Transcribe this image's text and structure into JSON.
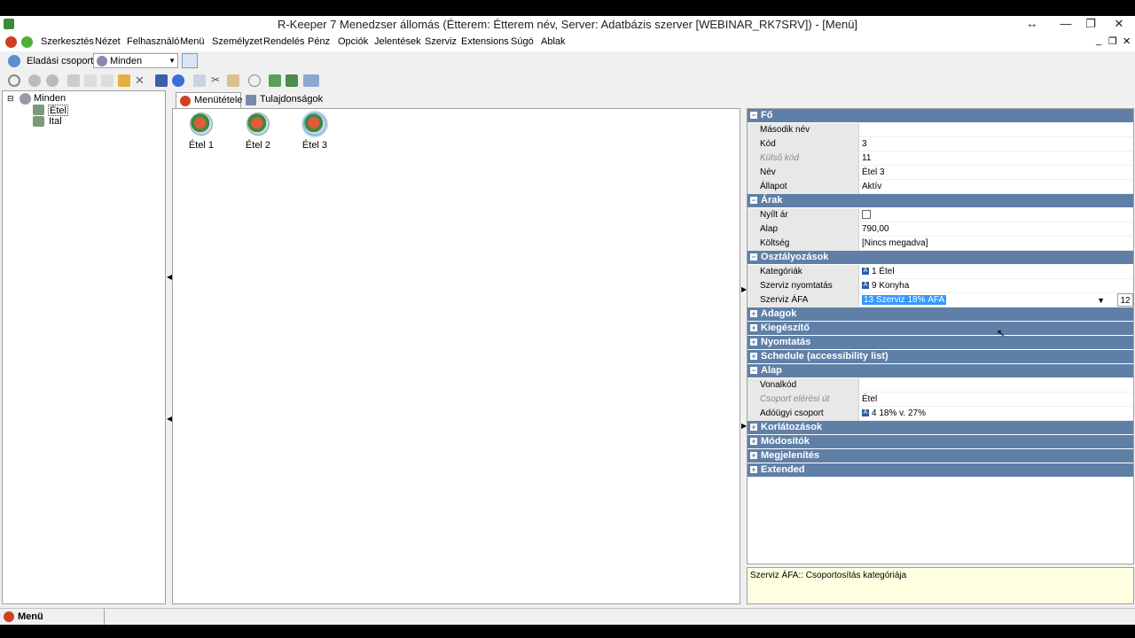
{
  "window": {
    "title": "R-Keeper 7 Menedzser állomás (Étterem: Étterem név, Server: Adatbázis szerver [WEBINAR_RK7SRV]) - [Menü]"
  },
  "menu": {
    "items": [
      "Szerkesztés",
      "Nézet",
      "Felhasználó",
      "Menü",
      "Személyzet",
      "Rendelés",
      "Pénz",
      "Opciók",
      "Jelentések",
      "Szerviz",
      "Extensions",
      "Súgó",
      "Ablak"
    ]
  },
  "groupbar": {
    "label": "Eladási csoport:",
    "selected": "Minden"
  },
  "tree": {
    "root": "Minden",
    "children": [
      "Étel",
      "Ital"
    ]
  },
  "tabs": {
    "menu_items": "Menütételek",
    "properties": "Tulajdonságok"
  },
  "menu_items": [
    "Étel 1",
    "Étel 2",
    "Étel 3"
  ],
  "props": {
    "cat_fo": "Fő",
    "masodik_nev_label": "Második név",
    "masodik_nev_value": "",
    "kod_label": "Kód",
    "kod_value": "3",
    "kulso_kod_label": "Külső kód",
    "kulso_kod_value": "11",
    "nev_label": "Név",
    "nev_value": "Étel 3",
    "allapot_label": "Állapot",
    "allapot_value": "Aktív",
    "cat_arak": "Árak",
    "nyilt_ar_label": "Nyílt ár",
    "alap_label": "Alap",
    "alap_value": "790,00",
    "koltseg_label": "Költség",
    "koltseg_value": "[Nincs megadva]",
    "cat_osztalyozasok": "Osztályozások",
    "kategoriak_label": "Kategóriák",
    "kategoriak_value": "1 Étel",
    "szerviz_nyomtatas_label": "Szerviz nyomtatás",
    "szerviz_nyomtatas_value": "9 Konyha",
    "szerviz_afa_label": "Szerviz ÁFA",
    "szerviz_afa_value": "13 Szerviz 18% ÁFA",
    "szerviz_afa_count": "12",
    "cat_adagok": "Adagok",
    "cat_kiegeszito": "Kiegészítő",
    "cat_nyomtatas": "Nyomtatás",
    "cat_schedule": "Schedule (accessibility list)",
    "cat_alap": "Alap",
    "vonalkod_label": "Vonalkód",
    "vonalkod_value": "",
    "csoport_eleresi_ut_label": "Csoport elérési út",
    "csoport_eleresi_ut_value": "Étel",
    "adougyi_csoport_label": "Adóügyi csoport",
    "adougyi_csoport_value": "4 18% v. 27%",
    "cat_korlatozasok": "Korlátozások",
    "cat_modositok": "Módosítók",
    "cat_megjelenites": "Megjelenítés",
    "cat_extended": "Extended"
  },
  "description": "Szerviz ÁFA:: Csoportosítás kategóriája",
  "status": {
    "label": "Menü"
  }
}
